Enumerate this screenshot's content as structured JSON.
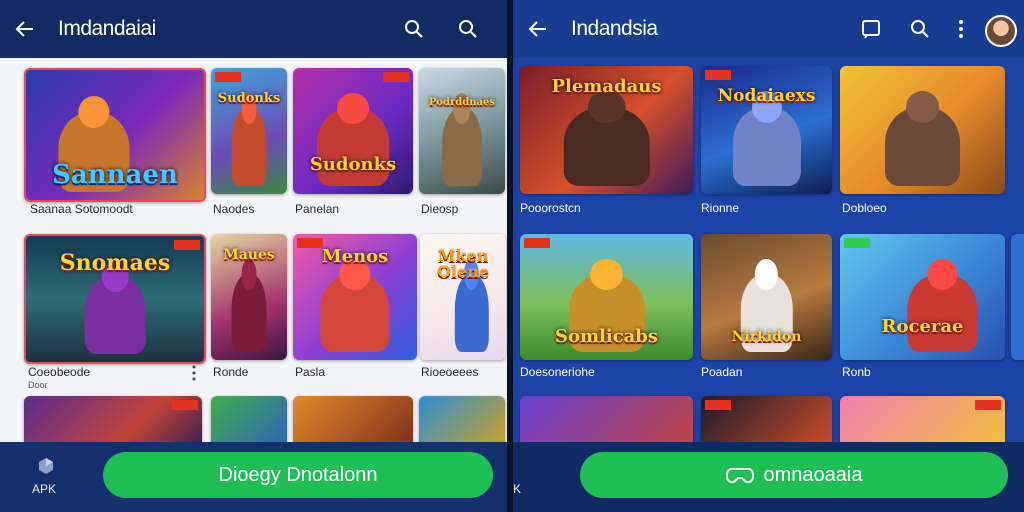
{
  "left": {
    "title": "Imdandaiai",
    "items": [
      {
        "label": "Sannaen",
        "caption": "Saanaa Sotomoodt",
        "sub": ""
      },
      {
        "label": "Sudonks",
        "caption": "Naodes",
        "sub": ""
      },
      {
        "label": "Sudonks",
        "caption": "Panelan",
        "sub": ""
      },
      {
        "label": "Podrddnaes",
        "caption": "Dieosp",
        "sub": ""
      },
      {
        "label": "Snomaes",
        "caption": "Coeobeode",
        "sub": "Door"
      },
      {
        "label": "Maues",
        "caption": "Ronde",
        "sub": ""
      },
      {
        "label": "Menos",
        "caption": "Pasla",
        "sub": ""
      },
      {
        "label": "Mken Olene",
        "caption": "Rioeoeees",
        "sub": ""
      }
    ],
    "cta_label": "Dioegy Dnotalonn",
    "apk_label": "APK"
  },
  "right": {
    "title": "Indandsia",
    "items": [
      {
        "label": "Plemadaus",
        "caption": "Pooorostcn"
      },
      {
        "label": "Nodaiaexs",
        "caption": "Rionne"
      },
      {
        "label": "",
        "caption": "Dobloeo"
      },
      {
        "label": "Somlicabs",
        "caption": "Doesoneriohe"
      },
      {
        "label": "Nirkidon",
        "caption": "Poadan"
      },
      {
        "label": "Rocerae",
        "caption": "Ronb"
      }
    ],
    "cta_label": "omnaoaaia",
    "apk_label": "K"
  },
  "colors": {
    "appbar": "#122c63",
    "cta_green": "#1fbf55",
    "right_bg": "#1e43a6"
  }
}
